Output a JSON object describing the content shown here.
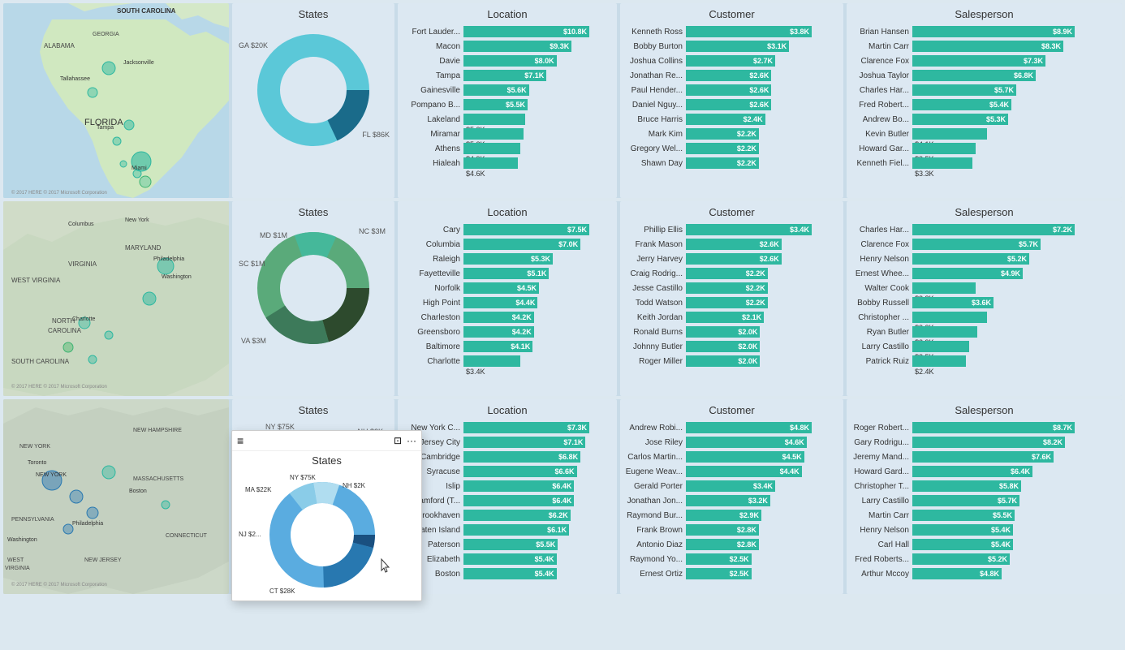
{
  "rows": [
    {
      "id": "row1",
      "mapType": "florida",
      "states": {
        "title": "States",
        "labels": [
          "GA $20K",
          "FL $86K"
        ],
        "donut": {
          "segments": [
            {
              "color": "#1a6b8a",
              "pct": 18
            },
            {
              "color": "#5bc8d8",
              "pct": 82
            }
          ]
        }
      },
      "location": {
        "title": "Location",
        "bars": [
          {
            "label": "Fort Lauder...",
            "value": "$10.8K",
            "pct": 100
          },
          {
            "label": "Macon",
            "value": "$9.3K",
            "pct": 86
          },
          {
            "label": "Davie",
            "value": "$8.0K",
            "pct": 74
          },
          {
            "label": "Tampa",
            "value": "$7.1K",
            "pct": 66
          },
          {
            "label": "Gainesville",
            "value": "$5.6K",
            "pct": 52
          },
          {
            "label": "Pompano B...",
            "value": "$5.5K",
            "pct": 51
          },
          {
            "label": "Lakeland",
            "value": "$5.3K",
            "pct": 49
          },
          {
            "label": "Miramar",
            "value": "$5.2K",
            "pct": 48
          },
          {
            "label": "Athens",
            "value": "$4.9K",
            "pct": 45
          },
          {
            "label": "Hialeah",
            "value": "$4.6K",
            "pct": 43
          }
        ]
      },
      "customer": {
        "title": "Customer",
        "bars": [
          {
            "label": "Kenneth Ross",
            "value": "$3.8K",
            "pct": 100
          },
          {
            "label": "Bobby Burton",
            "value": "$3.1K",
            "pct": 82
          },
          {
            "label": "Joshua Collins",
            "value": "$2.7K",
            "pct": 71
          },
          {
            "label": "Jonathan Re...",
            "value": "$2.6K",
            "pct": 68
          },
          {
            "label": "Paul Hender...",
            "value": "$2.6K",
            "pct": 68
          },
          {
            "label": "Daniel Nguy...",
            "value": "$2.6K",
            "pct": 68
          },
          {
            "label": "Bruce Harris",
            "value": "$2.4K",
            "pct": 63
          },
          {
            "label": "Mark Kim",
            "value": "$2.2K",
            "pct": 58
          },
          {
            "label": "Gregory Wel...",
            "value": "$2.2K",
            "pct": 58
          },
          {
            "label": "Shawn Day",
            "value": "$2.2K",
            "pct": 58
          }
        ]
      },
      "salesperson": {
        "title": "Salesperson",
        "bars": [
          {
            "label": "Brian Hansen",
            "value": "$8.9K",
            "pct": 100
          },
          {
            "label": "Martin Carr",
            "value": "$8.3K",
            "pct": 93
          },
          {
            "label": "Clarence Fox",
            "value": "$7.3K",
            "pct": 82
          },
          {
            "label": "Joshua Taylor",
            "value": "$6.8K",
            "pct": 76
          },
          {
            "label": "Charles Har...",
            "value": "$5.7K",
            "pct": 64
          },
          {
            "label": "Fred Robert...",
            "value": "$5.4K",
            "pct": 61
          },
          {
            "label": "Andrew Bo...",
            "value": "$5.3K",
            "pct": 59
          },
          {
            "label": "Kevin Butler",
            "value": "$4.1K",
            "pct": 46
          },
          {
            "label": "Howard Gar...",
            "value": "$3.5K",
            "pct": 39
          },
          {
            "label": "Kenneth Fiel...",
            "value": "$3.3K",
            "pct": 37
          }
        ]
      }
    },
    {
      "id": "row2",
      "mapType": "carolina",
      "states": {
        "title": "States",
        "labels": [
          "MD $1M",
          "SC $1M",
          "NC $3M",
          "VA $3M"
        ],
        "donut": {
          "segments": [
            {
              "color": "#2d4a2d",
              "pct": 25
            },
            {
              "color": "#3d7a5a",
              "pct": 25
            },
            {
              "color": "#5aaa7a",
              "pct": 35
            },
            {
              "color": "#45b89a",
              "pct": 15
            }
          ]
        }
      },
      "location": {
        "title": "Location",
        "bars": [
          {
            "label": "Cary",
            "value": "$7.5K",
            "pct": 100
          },
          {
            "label": "Columbia",
            "value": "$7.0K",
            "pct": 93
          },
          {
            "label": "Raleigh",
            "value": "$5.3K",
            "pct": 71
          },
          {
            "label": "Fayetteville",
            "value": "$5.1K",
            "pct": 68
          },
          {
            "label": "Norfolk",
            "value": "$4.5K",
            "pct": 60
          },
          {
            "label": "High Point",
            "value": "$4.4K",
            "pct": 59
          },
          {
            "label": "Charleston",
            "value": "$4.2K",
            "pct": 56
          },
          {
            "label": "Greensboro",
            "value": "$4.2K",
            "pct": 56
          },
          {
            "label": "Baltimore",
            "value": "$4.1K",
            "pct": 55
          },
          {
            "label": "Charlotte",
            "value": "$3.4K",
            "pct": 45
          }
        ]
      },
      "customer": {
        "title": "Customer",
        "bars": [
          {
            "label": "Phillip Ellis",
            "value": "$3.4K",
            "pct": 100
          },
          {
            "label": "Frank Mason",
            "value": "$2.6K",
            "pct": 76
          },
          {
            "label": "Jerry Harvey",
            "value": "$2.6K",
            "pct": 76
          },
          {
            "label": "Craig Rodrig...",
            "value": "$2.2K",
            "pct": 65
          },
          {
            "label": "Jesse Castillo",
            "value": "$2.2K",
            "pct": 65
          },
          {
            "label": "Todd Watson",
            "value": "$2.2K",
            "pct": 65
          },
          {
            "label": "Keith Jordan",
            "value": "$2.1K",
            "pct": 62
          },
          {
            "label": "Ronald Burns",
            "value": "$2.0K",
            "pct": 59
          },
          {
            "label": "Johnny Butler",
            "value": "$2.0K",
            "pct": 59
          },
          {
            "label": "Roger Miller",
            "value": "$2.0K",
            "pct": 59
          }
        ]
      },
      "salesperson": {
        "title": "Salesperson",
        "bars": [
          {
            "label": "Charles Har...",
            "value": "$7.2K",
            "pct": 100
          },
          {
            "label": "Clarence Fox",
            "value": "$5.7K",
            "pct": 79
          },
          {
            "label": "Henry Nelson",
            "value": "$5.2K",
            "pct": 72
          },
          {
            "label": "Ernest Whee...",
            "value": "$4.9K",
            "pct": 68
          },
          {
            "label": "Walter Cook",
            "value": "$2.8K",
            "pct": 39
          },
          {
            "label": "Bobby Russell",
            "value": "$3.6K",
            "pct": 50
          },
          {
            "label": "Christopher ...",
            "value": "$3.3K",
            "pct": 46
          },
          {
            "label": "Ryan Butler",
            "value": "$2.9K",
            "pct": 40
          },
          {
            "label": "Larry Castillo",
            "value": "$2.5K",
            "pct": 35
          },
          {
            "label": "Patrick Ruiz",
            "value": "$2.4K",
            "pct": 33
          }
        ]
      }
    },
    {
      "id": "row3",
      "mapType": "northeast",
      "states": {
        "title": "States",
        "labels": [
          "NH $2K",
          "MA $22K",
          "NJ $2...",
          "NY $75K",
          "CT $28K"
        ],
        "donut": {
          "segments": [
            {
              "color": "#1a5080",
              "pct": 5
            },
            {
              "color": "#2878b0",
              "pct": 25
            },
            {
              "color": "#5aace0",
              "pct": 50
            },
            {
              "color": "#8acce8",
              "pct": 10
            },
            {
              "color": "#b0ddf0",
              "pct": 10
            }
          ]
        }
      },
      "location": {
        "title": "Location",
        "bars": [
          {
            "label": "New York C...",
            "value": "$7.3K",
            "pct": 100
          },
          {
            "label": "Jersey City",
            "value": "$7.1K",
            "pct": 97
          },
          {
            "label": "Cambridge",
            "value": "$6.8K",
            "pct": 93
          },
          {
            "label": "Syracuse",
            "value": "$6.6K",
            "pct": 90
          },
          {
            "label": "Islip",
            "value": "$6.4K",
            "pct": 88
          },
          {
            "label": "Stamford (T...",
            "value": "$6.4K",
            "pct": 88
          },
          {
            "label": "Brookhaven",
            "value": "$6.2K",
            "pct": 85
          },
          {
            "label": "Staten Island",
            "value": "$6.1K",
            "pct": 84
          },
          {
            "label": "Paterson",
            "value": "$5.5K",
            "pct": 75
          },
          {
            "label": "Elizabeth",
            "value": "$5.4K",
            "pct": 74
          },
          {
            "label": "Boston",
            "value": "$5.4K",
            "pct": 74
          }
        ]
      },
      "customer": {
        "title": "Customer",
        "bars": [
          {
            "label": "Andrew Robi...",
            "value": "$4.8K",
            "pct": 100
          },
          {
            "label": "Jose Riley",
            "value": "$4.6K",
            "pct": 96
          },
          {
            "label": "Carlos Martin...",
            "value": "$4.5K",
            "pct": 94
          },
          {
            "label": "Eugene Weav...",
            "value": "$4.4K",
            "pct": 92
          },
          {
            "label": "Gerald Porter",
            "value": "$3.4K",
            "pct": 71
          },
          {
            "label": "Jonathan Jon...",
            "value": "$3.2K",
            "pct": 67
          },
          {
            "label": "Raymond Bur...",
            "value": "$2.9K",
            "pct": 60
          },
          {
            "label": "Frank Brown",
            "value": "$2.8K",
            "pct": 58
          },
          {
            "label": "Antonio Diaz",
            "value": "$2.8K",
            "pct": 58
          },
          {
            "label": "Raymond Yo...",
            "value": "$2.5K",
            "pct": 52
          },
          {
            "label": "Ernest Ortiz",
            "value": "$2.5K",
            "pct": 52
          }
        ]
      },
      "salesperson": {
        "title": "Salesperson",
        "bars": [
          {
            "label": "Roger Robert...",
            "value": "$8.7K",
            "pct": 100
          },
          {
            "label": "Gary Rodrigu...",
            "value": "$8.2K",
            "pct": 94
          },
          {
            "label": "Jeremy Mand...",
            "value": "$7.6K",
            "pct": 87
          },
          {
            "label": "Howard Gard...",
            "value": "$6.4K",
            "pct": 74
          },
          {
            "label": "Christopher T...",
            "value": "$5.8K",
            "pct": 67
          },
          {
            "label": "Larry Castillo",
            "value": "$5.7K",
            "pct": 66
          },
          {
            "label": "Martin Carr",
            "value": "$5.5K",
            "pct": 63
          },
          {
            "label": "Henry Nelson",
            "value": "$5.4K",
            "pct": 62
          },
          {
            "label": "Carl Hall",
            "value": "$5.4K",
            "pct": 62
          },
          {
            "label": "Fred Roberts...",
            "value": "$5.2K",
            "pct": 60
          },
          {
            "label": "Arthur Mccoy",
            "value": "$4.8K",
            "pct": 55
          }
        ]
      }
    }
  ],
  "popup": {
    "title": "",
    "icons": [
      "≡",
      "⊡",
      "..."
    ]
  }
}
